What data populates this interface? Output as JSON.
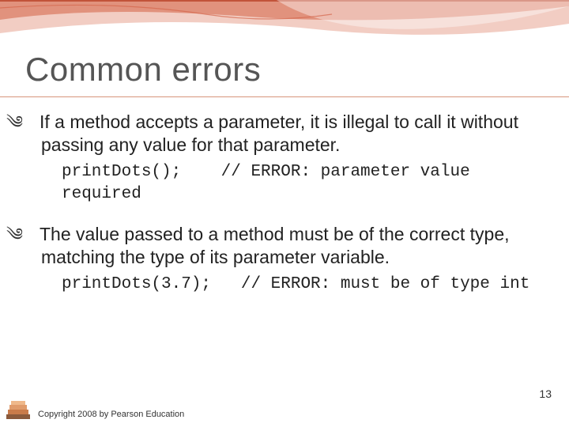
{
  "title": "Common errors",
  "bullets": [
    {
      "text": "If a method accepts a parameter, it is illegal to call it without passing any value for that parameter.",
      "code": "printDots();    // ERROR: parameter value required"
    },
    {
      "text": "The value passed to a method must be of the correct type, matching the type of its parameter variable.",
      "code": "printDots(3.7);   // ERROR: must be of type int"
    }
  ],
  "page_number": "13",
  "copyright": "Copyright 2008 by Pearson Education"
}
